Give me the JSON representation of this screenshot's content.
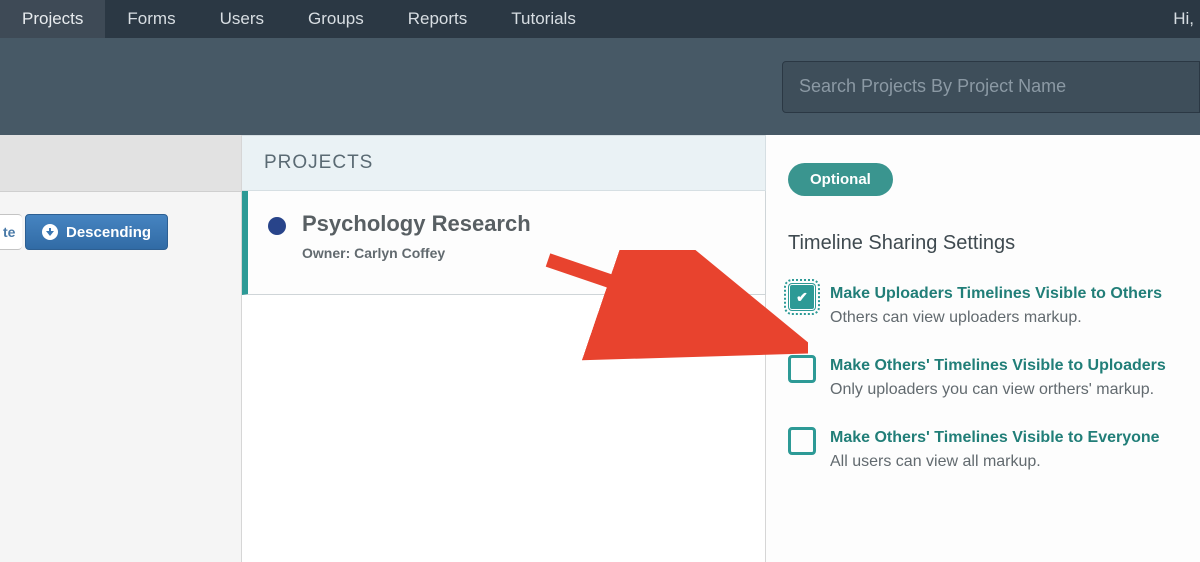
{
  "nav": {
    "items": [
      "Projects",
      "Forms",
      "Users",
      "Groups",
      "Reports",
      "Tutorials"
    ],
    "active_index": 0,
    "greeting": "Hi,"
  },
  "search": {
    "placeholder": "Search Projects By Project Name"
  },
  "sort": {
    "partial_left": "te",
    "descending_label": "Descending"
  },
  "projects_panel": {
    "header": "PROJECTS",
    "items": [
      {
        "title": "Psychology Research",
        "owner_label": "Owner: Carlyn Coffey",
        "dot_color": "#28448a"
      }
    ]
  },
  "settings_panel": {
    "badge": "Optional",
    "title": "Timeline Sharing Settings",
    "options": [
      {
        "checked": true,
        "label": "Make Uploaders Timelines Visible to Others",
        "desc": "Others can view uploaders markup."
      },
      {
        "checked": false,
        "label": "Make Others' Timelines Visible to Uploaders",
        "desc": "Only uploaders you can view orthers' markup."
      },
      {
        "checked": false,
        "label": "Make Others' Timelines Visible to Everyone",
        "desc": "All users can view all markup."
      }
    ]
  },
  "annotation": {
    "arrow_color": "#e8432e"
  }
}
